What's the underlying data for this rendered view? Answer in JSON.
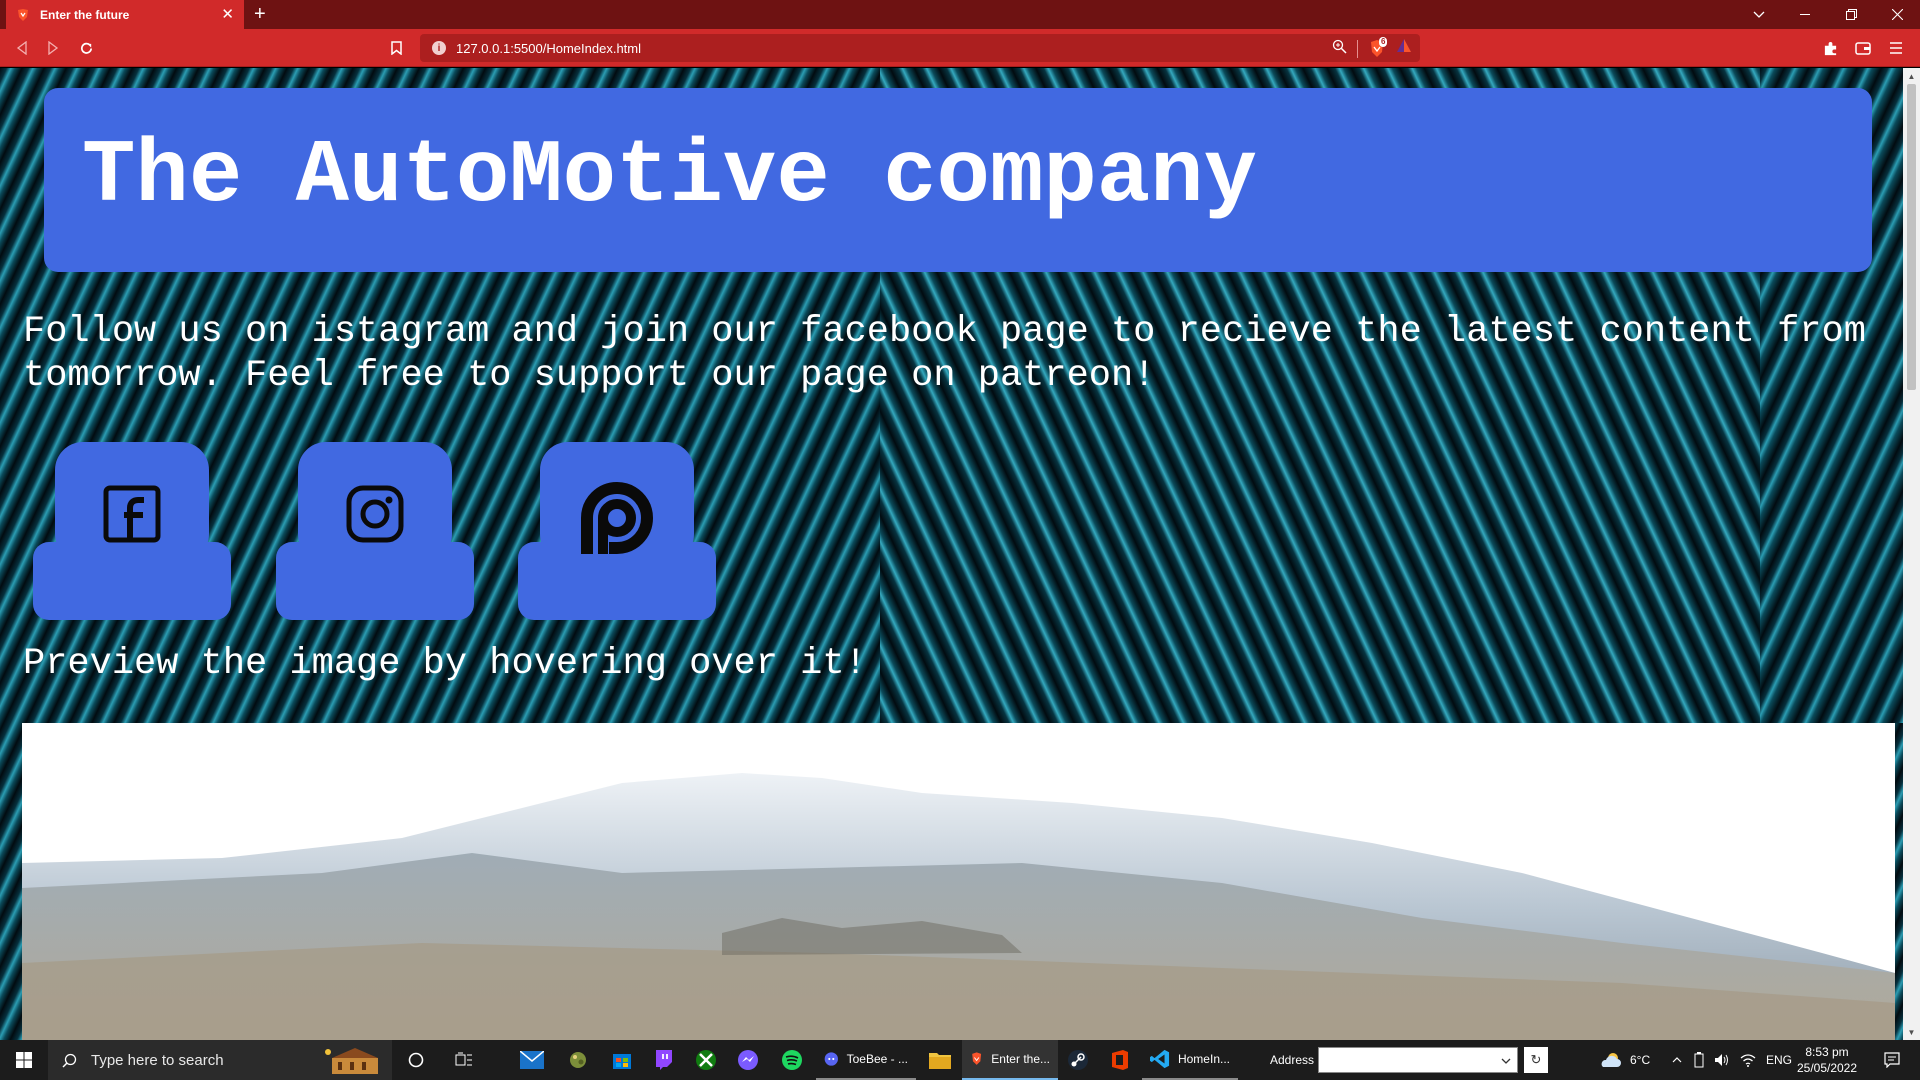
{
  "browser": {
    "tab_title": "Enter the future",
    "tab_close": "✕",
    "new_tab": "+",
    "url": "127.0.0.1:5500/HomeIndex.html",
    "url_info": "i",
    "shield_count": "6"
  },
  "page": {
    "title": "The AutoMotive company",
    "follow_text": "Follow us on istagram and join our facebook page to recieve the latest content from tomorrow. Feel free to support our page on patreon!",
    "social": [
      {
        "name": "facebook"
      },
      {
        "name": "instagram"
      },
      {
        "name": "patreon"
      }
    ],
    "preview_text": "Preview the image by hovering over it!"
  },
  "taskbar": {
    "search_placeholder": "Type here to search",
    "apps": [
      {
        "label": "ToeBee - ..."
      },
      {
        "label": "Enter the..."
      },
      {
        "label": "HomeIn..."
      }
    ],
    "address_label": "Address",
    "address_value": "",
    "weather": "6°C",
    "language": "ENG",
    "time": "8:53 pm",
    "date": "25/05/2022"
  },
  "colors": {
    "chrome_red": "#d12a2a",
    "header_blue": "#4169e1"
  }
}
